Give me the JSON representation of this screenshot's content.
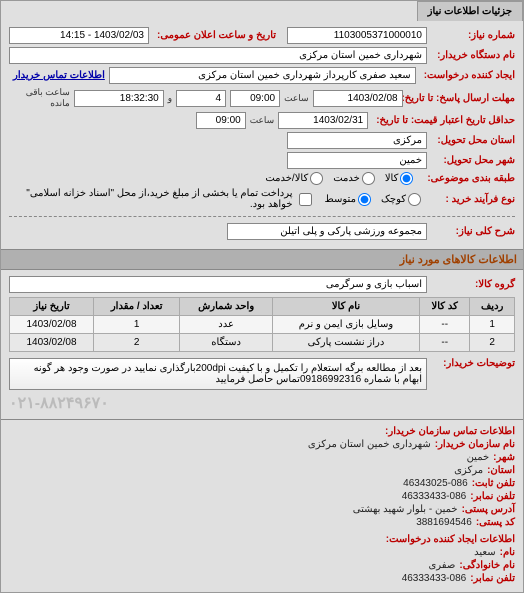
{
  "tab_title": "جزئیات اطلاعات نیاز",
  "fields": {
    "need_number_lbl": "شماره نیاز:",
    "need_number": "1103005371000010",
    "announce_lbl": "تاریخ و ساعت اعلان عمومی:",
    "announce_val": "1403/02/03 - 14:15",
    "buyer_device_lbl": "نام دستگاه خریدار:",
    "buyer_device": "شهرداری خمین استان مرکزی",
    "creator_lbl": "ایجاد کننده درخواست:",
    "creator": "سعید صفری کارپرداز شهرداری خمین استان مرکزی",
    "contact_link": "اطلاعات تماس خریدار",
    "deadline_lbl": "مهلت ارسال پاسخ: تا تاریخ:",
    "deadline_date": "1403/02/08",
    "time_lbl": "ساعت",
    "deadline_time": "09:00",
    "days_remain": "4",
    "time_remain": "18:32:30",
    "remain_lbl": "ساعت باقی مانده",
    "validity_lbl": "حداقل تاریخ اعتبار قیمت: تا تاریخ:",
    "validity_date": "1403/02/31",
    "validity_time": "09:00",
    "province_lbl": "استان محل تحویل:",
    "province": "مرکزی",
    "city_lbl": "شهر محل تحویل:",
    "city": "خمین",
    "subject_lbl": "طبقه بندی موضوعی:",
    "r_goods": "کالا",
    "r_service": "خدمت",
    "r_goods_service": "کالا/خدمت",
    "process_lbl": "نوع فرآیند خرید :",
    "r_small": "کوچک",
    "r_medium": "متوسط",
    "process_note": "پرداخت تمام یا بخشی از مبلغ خرید،از محل \"اسناد خزانه اسلامی\" خواهد بود.",
    "desc_lbl": "شرح کلی نیاز:",
    "desc": "مجموعه ورزشی پارکی و پلی اتیلن"
  },
  "items_header": "اطلاعات کالاهای مورد نیاز",
  "group_lbl": "گروه کالا:",
  "group_val": "اسباب بازی و سرگرمی",
  "table": {
    "headers": [
      "ردیف",
      "کد کالا",
      "نام کالا",
      "واحد شمارش",
      "تعداد / مقدار",
      "تاریخ نیاز"
    ],
    "rows": [
      [
        "1",
        "--",
        "وسایل بازی ایمن و نرم",
        "عدد",
        "1",
        "1403/02/08"
      ],
      [
        "2",
        "--",
        "دراز نشست پارکی",
        "دستگاه",
        "2",
        "1403/02/08"
      ]
    ]
  },
  "buyer_notes_lbl": "توضیحات خریدار:",
  "buyer_notes": "بعد از مطالعه برگه استعلام را تکمیل و با کیفیت 200dpiبارگذاری نمایید در صورت وجود هر گونه ابهام با شماره 09186992316تماس حاصل فرمایید",
  "phone_big": "۰۲۱-۸۸۲۴۹۶۷۰",
  "contact_header": "اطلاعات تماس سازمان خریدار:",
  "contact": {
    "org_lbl": "نام سازمان خریدار:",
    "org": "شهرداری خمین استان مرکزی",
    "city_lbl": "شهر:",
    "city": "خمین",
    "prov_lbl": "استان:",
    "prov": "مرکزی",
    "tel_lbl": "تلفن ثابت:",
    "tel": "46343025-086",
    "fax_lbl": "تلفن نمابر:",
    "fax": "46333433-086",
    "addr_lbl": "آدرس پستی:",
    "addr": "خمین - بلوار شهید بهشتی",
    "post_lbl": "کد پستی:",
    "post": "3881694546"
  },
  "creator_header": "اطلاعات ایجاد کننده درخواست:",
  "creator_info": {
    "fname_lbl": "نام:",
    "fname": "سعید",
    "lname_lbl": "نام خانوادگی:",
    "lname": "صفری",
    "tel_lbl": "تلفن نمابر:",
    "tel": "46333433-086"
  }
}
